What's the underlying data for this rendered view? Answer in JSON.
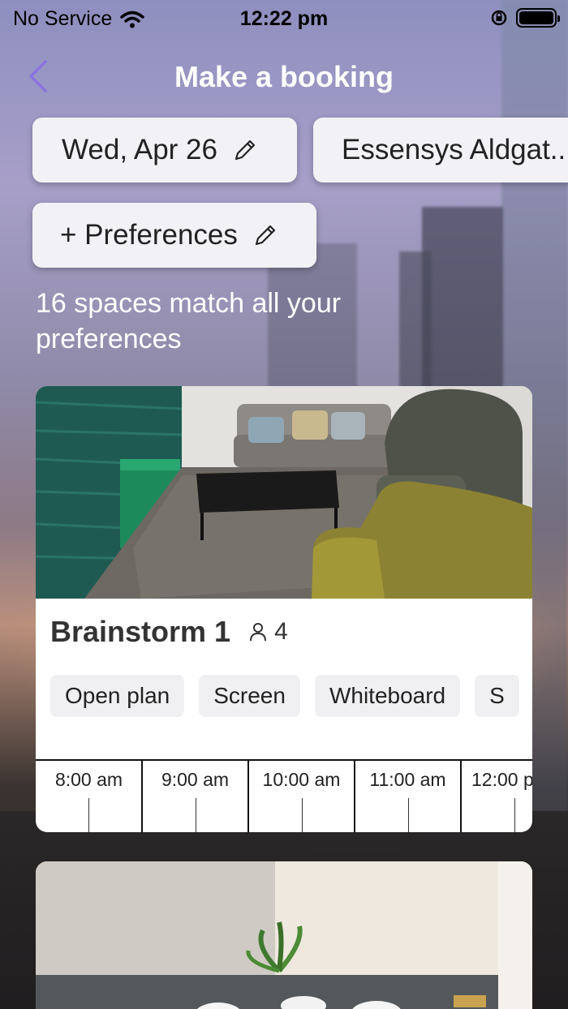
{
  "status_bar": {
    "carrier": "No Service",
    "time": "12:22 pm"
  },
  "nav": {
    "title": "Make a booking"
  },
  "filters": {
    "date": "Wed, Apr 26",
    "location": "Essensys Aldgat...",
    "preferences": "+ Preferences"
  },
  "results": {
    "match_text": "16 spaces match all your preferences"
  },
  "spaces": [
    {
      "name": "Brainstorm 1",
      "capacity": "4",
      "tags": [
        "Open plan",
        "Screen",
        "Whiteboard",
        "S"
      ],
      "timeline": [
        "8:00 am",
        "9:00 am",
        "10:00 am",
        "11:00 am",
        "12:00 p"
      ]
    }
  ],
  "colors": {
    "accent": "#8a73e0",
    "card_bg": "#ffffff",
    "chip_bg": "#f2f2f6"
  }
}
